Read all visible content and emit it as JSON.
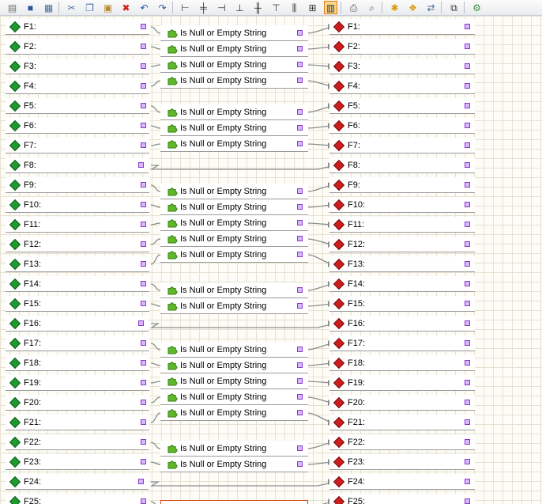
{
  "toolbar": {
    "groups": [
      [
        {
          "icon": "properties-icon",
          "glyph": "▤",
          "color": "#6b6b6b"
        },
        {
          "icon": "save-icon",
          "glyph": "■",
          "color": "#2b55a3"
        },
        {
          "icon": "save-as-icon",
          "glyph": "▦",
          "color": "#4b6e96"
        }
      ],
      [
        {
          "icon": "cut-icon",
          "glyph": "✂",
          "color": "#4a6fa5"
        },
        {
          "icon": "copy-icon",
          "glyph": "❐",
          "color": "#4a6fa5"
        },
        {
          "icon": "paste-icon",
          "glyph": "▣",
          "color": "#b8892e"
        },
        {
          "icon": "delete-icon",
          "glyph": "✖",
          "color": "#d0201a"
        },
        {
          "icon": "undo-icon",
          "glyph": "↶",
          "color": "#2b55a3"
        },
        {
          "icon": "redo-icon",
          "glyph": "↷",
          "color": "#2b55a3"
        }
      ],
      [
        {
          "icon": "align-left-icon",
          "glyph": "⊢",
          "color": "#333333"
        },
        {
          "icon": "align-center-icon",
          "glyph": "╪",
          "color": "#333333"
        },
        {
          "icon": "align-right-icon",
          "glyph": "⊣",
          "color": "#333333"
        },
        {
          "icon": "align-bottom-icon",
          "glyph": "⊥",
          "color": "#333333"
        },
        {
          "icon": "align-middle-icon",
          "glyph": "╫",
          "color": "#333333"
        },
        {
          "icon": "align-top-icon",
          "glyph": "⊤",
          "color": "#333333"
        },
        {
          "icon": "distribute-icon",
          "glyph": "⫼",
          "color": "#333333"
        },
        {
          "icon": "same-size-icon",
          "glyph": "⊞",
          "color": "#333333"
        },
        {
          "icon": "auto-layout-icon",
          "glyph": "▥",
          "color": "#333333",
          "pressed": true
        }
      ],
      [
        {
          "icon": "print-icon",
          "glyph": "⎙",
          "color": "#555555"
        },
        {
          "icon": "print-preview-icon",
          "glyph": "⌕",
          "color": "#555555"
        }
      ],
      [
        {
          "icon": "add-expression-icon",
          "glyph": "✱",
          "color": "#d59a10"
        },
        {
          "icon": "lookup-icon",
          "glyph": "❖",
          "color": "#d59a10"
        },
        {
          "icon": "mapping-icon",
          "glyph": "⇄",
          "color": "#4b6e96"
        }
      ],
      [
        {
          "icon": "variables-icon",
          "glyph": "⧉",
          "color": "#333333"
        }
      ],
      [
        {
          "icon": "run-icon",
          "glyph": "⚙",
          "color": "#3c8f3c"
        }
      ]
    ]
  },
  "function_label": "Is Null or Empty String",
  "rows": [
    {
      "label": "F1:",
      "fn": true
    },
    {
      "label": "F2:",
      "fn": true
    },
    {
      "label": "F3:",
      "fn": true
    },
    {
      "label": "F4:",
      "fn": true
    },
    {
      "label": "F5:",
      "fn": true
    },
    {
      "label": "F6:",
      "fn": true
    },
    {
      "label": "F7:",
      "fn": true
    },
    {
      "label": "F8:",
      "fn": false
    },
    {
      "label": "F9:",
      "fn": true
    },
    {
      "label": "F10:",
      "fn": true
    },
    {
      "label": "F11:",
      "fn": true
    },
    {
      "label": "F12:",
      "fn": true
    },
    {
      "label": "F13:",
      "fn": true
    },
    {
      "label": "F14:",
      "fn": true
    },
    {
      "label": "F15:",
      "fn": true
    },
    {
      "label": "F16:",
      "fn": false
    },
    {
      "label": "F17:",
      "fn": true
    },
    {
      "label": "F18:",
      "fn": true
    },
    {
      "label": "F19:",
      "fn": true
    },
    {
      "label": "F20:",
      "fn": true
    },
    {
      "label": "F21:",
      "fn": true
    },
    {
      "label": "F22:",
      "fn": true
    },
    {
      "label": "F23:",
      "fn": true
    },
    {
      "label": "F24:",
      "fn": false
    },
    {
      "label": "F25:",
      "fn": true,
      "selected": true
    }
  ],
  "colors": {
    "source_gem": "#1f9a2f",
    "target_gem": "#cc1e1e",
    "pin": "#d9b7ff",
    "wire": "#8c8c8c",
    "selection": "#d9480f",
    "grid": "#e6e2d3"
  }
}
